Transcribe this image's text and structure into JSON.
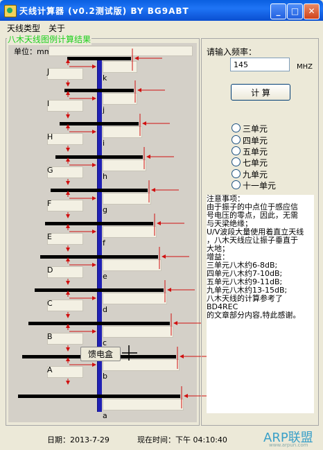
{
  "window": {
    "title": "天线计算器 (v0.2测试版)  BY BG9ABT",
    "minimize": "_",
    "maximize": "□",
    "close": "✕"
  },
  "menu": {
    "items": [
      "天线类型",
      "关于"
    ]
  },
  "diagram": {
    "group_title": "八木天线图例计算结果",
    "unit_label": "单位：mm",
    "feed_button": "馈电盒",
    "letters_left": [
      "J",
      "I",
      "H",
      "G",
      "F",
      "E",
      "D",
      "C",
      "B",
      "A"
    ],
    "letters_right": [
      "k",
      "j",
      "i",
      "h",
      "g",
      "f",
      "e",
      "d",
      "c",
      "b",
      "a"
    ]
  },
  "side": {
    "freq_label": "请输入频率：",
    "freq_value": "145",
    "freq_unit": "MHZ",
    "calc_button": "计  算",
    "options": [
      "三单元",
      "四单元",
      "五单元",
      "七单元",
      "九单元",
      "十一单元"
    ],
    "notes": [
      "注意事项：",
      "由于振子的中点位于感应信",
      "号电压的零点，因此，无需",
      "与天梁绝缘；",
      "U/V波段大量使用着直立天线",
      "，八木天线应让振子垂直于",
      "大地；",
      "增益：",
      "三单元八木约6-8dB;",
      "四单元八木约7-10dB;",
      "五单元八木约9-11dB;",
      "九单元八木约13-15dB;",
      "八木天线的计算参考了",
      "BD4REC",
      "的文章部分内容,特此感谢。"
    ]
  },
  "status": {
    "date": "日期：2013-7-29",
    "time": "现在时间：下午  04:10:40"
  },
  "watermark": {
    "brand": "ARP联盟",
    "url": "www.arpun.com"
  },
  "colors": {
    "boom": "#2020b4",
    "arrows": "#d01010",
    "group_title": "#1cd01c",
    "titlebar": "#0a5fe0"
  }
}
